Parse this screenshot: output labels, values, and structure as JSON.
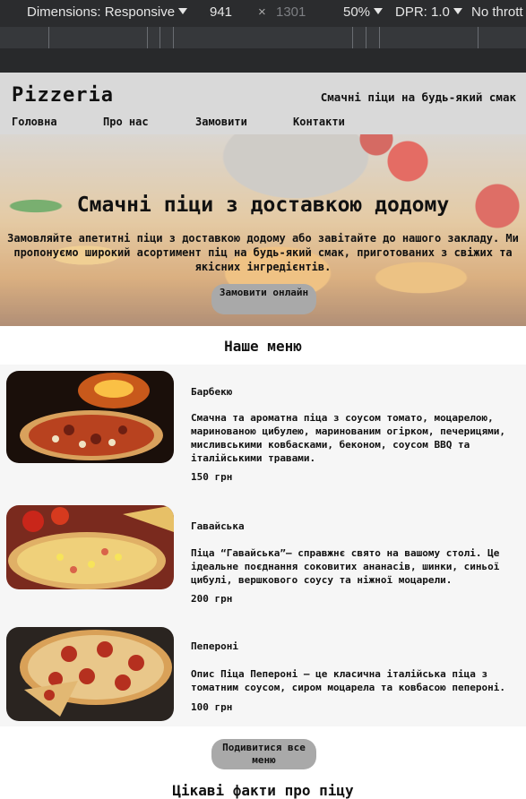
{
  "devtools": {
    "dimensions_label": "Dimensions: Responsive",
    "width": "941",
    "times": "×",
    "height": "1301",
    "zoom": "50%",
    "dpr": "DPR: 1.0",
    "throttle": "No thrott"
  },
  "site": {
    "brand": "Pizzeria",
    "tagline": "Смачні піци на будь-який смак",
    "nav": [
      "Головна",
      "Про нас",
      "Замовити",
      "Контакти"
    ]
  },
  "hero": {
    "title": "Смачні піци з доставкою додому",
    "text": "Замовляйте апетитні піци з доставкою додому або завітайте до нашого закладу. Ми пропонуємо широкий асортимент піц на будь-який смак, приготованих з свіжих та якісних інгредієнтів.",
    "button": "Замовити онлайн"
  },
  "menu": {
    "title": "Наше меню",
    "items": [
      {
        "name": "Барбекю",
        "description": "Смачна та ароматна піца з соусом томато, моцарелою, маринованою цибулею, маринованим огірком, печерицями, мисливськими ковбасками, беконом, соусом BBQ та італійськими травами.",
        "price": "150 грн"
      },
      {
        "name": "Гавайська",
        "description": "Піца “Гавайська”— справжнє свято на вашому столі. Це ідеальне поєднання соковитих ананасів, шинки, синьої цибулі, вершкового соусу та ніжної моцарели.",
        "price": "200 грн"
      },
      {
        "name": "Пепероні",
        "description": "Опис Піца Пепероні – це класична італійська піца з томатним соусом, сиром моцарела та ковбасою пепероні.",
        "price": "100 грн"
      }
    ],
    "more_button": "Подивитися все меню"
  },
  "facts": {
    "title": "Цікаві факти про піцу"
  }
}
